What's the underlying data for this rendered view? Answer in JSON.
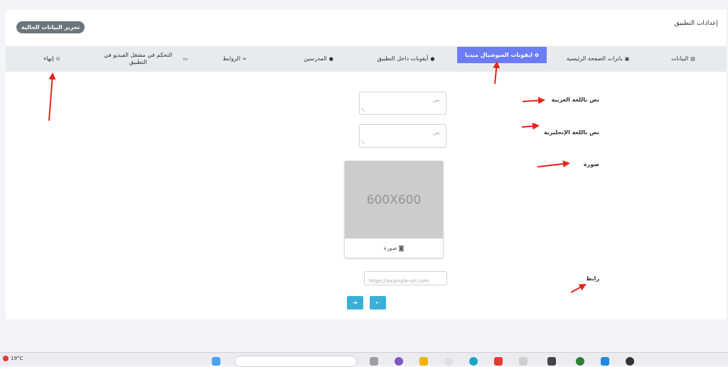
{
  "page": {
    "title": "إعدادات التطبيق",
    "edit_button": "تحرير البيانات الحالية"
  },
  "tabs": [
    {
      "label": "البيانات",
      "icon": "▤"
    },
    {
      "label": "بانرات الصفحة الرئيسية",
      "icon": "▣"
    },
    {
      "label": "ايقونات السوشيال ميديا",
      "icon": "❶"
    },
    {
      "label": "أيقونات داخل التطبيق",
      "icon": "●"
    },
    {
      "label": "المدرسين",
      "icon": "●"
    },
    {
      "label": "الروابط",
      "icon": "∞"
    },
    {
      "label": "التحكم في مشغل الفيديو في التطبيق",
      "icon": "▭"
    },
    {
      "label": "إنهاء",
      "icon": "⊙"
    }
  ],
  "form": {
    "arabic_label": "نص باللغة العربية",
    "arabic_placeholder": "نص",
    "english_label": "نص باللغة الإنجليزية",
    "english_placeholder": "نص",
    "image_label": "صورة",
    "image_placeholder": "600X600",
    "image_caption": "صورة",
    "link_label": "رابط",
    "link_placeholder": "https://example-url.com"
  },
  "nav": {
    "next_icon": "➜",
    "prev_icon": "⇠"
  },
  "taskbar": {
    "weather": "19°C"
  },
  "colors": {
    "active_tab": "#6c7cf5",
    "nav_button": "#3ab0d8",
    "edit_button": "#6c757d",
    "arrow": "#e8221a"
  }
}
